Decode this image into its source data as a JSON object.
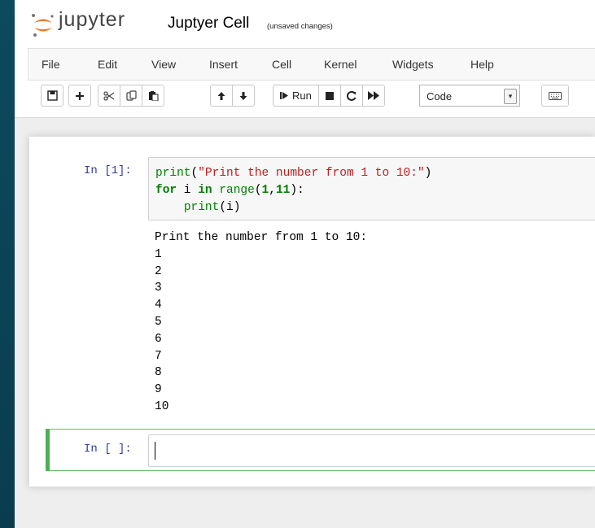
{
  "header": {
    "brand": "jupyter",
    "notebook_name": "Juptyer Cell",
    "status": "(unsaved changes)",
    "logo_icon": "jupyter-logo-icon",
    "accent_color": "#f37726"
  },
  "menu": {
    "items": [
      "File",
      "Edit",
      "View",
      "Insert",
      "Cell",
      "Kernel",
      "Widgets",
      "Help"
    ]
  },
  "toolbar": {
    "run_label": "Run",
    "cell_type": "Code",
    "icons": [
      "save-icon",
      "plus-icon",
      "scissors-icon",
      "copy-icon",
      "paste-icon",
      "arrow-up-icon",
      "arrow-down-icon",
      "run-icon",
      "stop-icon",
      "restart-icon",
      "fast-forward-icon",
      "keyboard-icon"
    ]
  },
  "cells": [
    {
      "prompt": "In [1]:",
      "code_lines": [
        "print(\"Print the number from 1 to 10:\")",
        "for i in range(1,11):",
        "    print(i)"
      ],
      "output": "Print the number from 1 to 10:\n1\n2\n3\n4\n5\n6\n7\n8\n9\n10"
    },
    {
      "prompt": "In [ ]:",
      "code": ""
    }
  ]
}
